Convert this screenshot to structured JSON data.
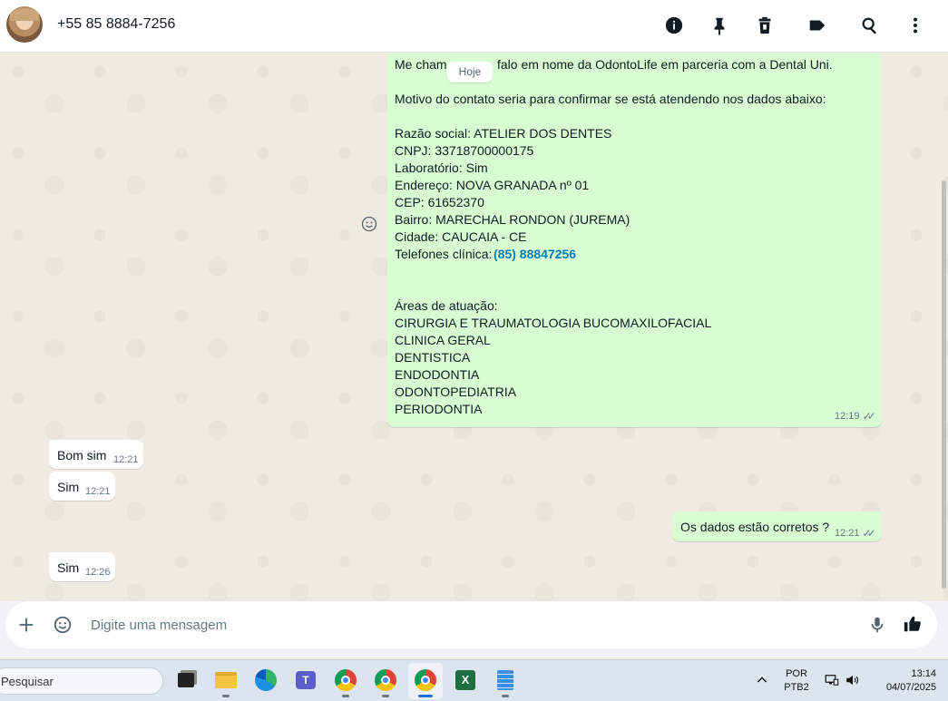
{
  "header": {
    "contact_name": "+55 85 8884-7256",
    "icons": [
      "info-icon",
      "pin-icon",
      "delete-icon",
      "label-icon",
      "search-icon",
      "menu-icon"
    ]
  },
  "chat": {
    "date_chip": "Hoje",
    "big_message": {
      "lines": [
        "Me cham",
        "falo em nome da OdontoLife em parceria com a Dental Uni.",
        "Motivo do contato seria para confirmar se está atendendo nos dados abaixo:",
        "Razão social: ATELIER DOS DENTES",
        "CNPJ: 33718700000175",
        "Laboratório: Sim",
        "Endereço: NOVA GRANADA nº 01",
        "CEP: 61652370",
        "Bairro: MARECHAL RONDON (JUREMA)",
        "Cidade: CAUCAIA - CE",
        "Telefones clínica:",
        "Áreas de atuação:",
        "CIRURGIA E TRAUMATOLOGIA BUCOMAXILOFACIAL",
        "CLINICA GERAL",
        "DENTISTICA",
        "ENDODONTIA",
        "ODONTOPEDIATRIA",
        "PERIODONTIA"
      ],
      "phone": "(85) 88847256",
      "time": "12:19"
    },
    "incoming": [
      {
        "text": "Bom sim",
        "time": "12:21"
      },
      {
        "text": "Sim",
        "time": "12:21"
      },
      {
        "text": "Sim",
        "time": "12:26"
      }
    ],
    "outgoing": [
      {
        "text": "Os dados estão corretos ?",
        "time": "12:21"
      }
    ]
  },
  "composer": {
    "placeholder": "Digite uma mensagem"
  },
  "taskbar": {
    "search_label": "Pesquisar",
    "lang_top": "POR",
    "lang_bottom": "PTB2",
    "clock_time": "13:14",
    "clock_date": "04/07/2025"
  },
  "colors": {
    "outgoing_bubble": "#d9fdd3",
    "incoming_bubble": "#ffffff",
    "chat_bg": "#efeae2",
    "link": "#027eb5"
  }
}
